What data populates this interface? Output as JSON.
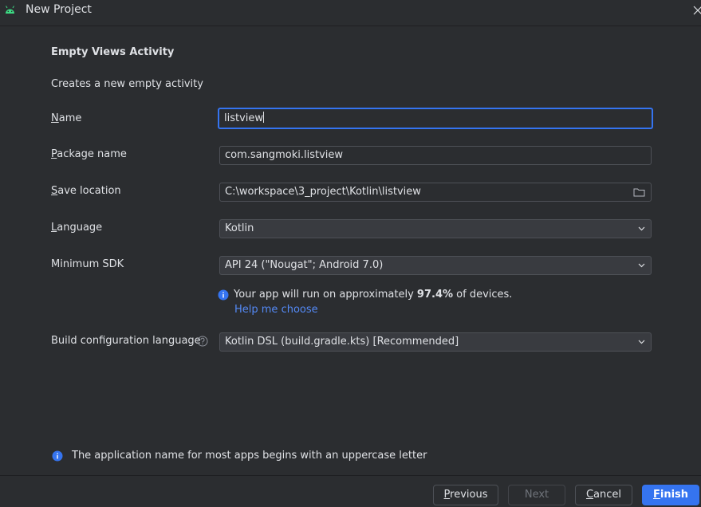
{
  "window": {
    "title": "New Project"
  },
  "template": {
    "title": "Empty Views Activity",
    "description": "Creates a new empty activity"
  },
  "form": {
    "name": {
      "label_mnemonic": "N",
      "label_rest": "ame",
      "value": "listview"
    },
    "package": {
      "label_mnemonic": "P",
      "label_rest": "ackage name",
      "value": "com.sangmoki.listview"
    },
    "save_location": {
      "label_mnemonic": "S",
      "label_rest": "ave location",
      "value": "C:\\workspace\\3_project\\Kotlin\\listview"
    },
    "language": {
      "label_mnemonic": "L",
      "label_rest": "anguage",
      "value": "Kotlin"
    },
    "min_sdk": {
      "label": "Minimum SDK",
      "value": "API 24 (\"Nougat\"; Android 7.0)"
    },
    "sdk_info": {
      "prefix": "Your app will run on approximately ",
      "percent": "97.4%",
      "suffix": " of devices.",
      "help_link": "Help me choose"
    },
    "build_config": {
      "label": "Build configuration language",
      "value": "Kotlin DSL (build.gradle.kts) [Recommended]"
    }
  },
  "bottom_note": "The application name for most apps begins with an uppercase letter",
  "buttons": {
    "previous": {
      "mnemonic": "P",
      "rest": "revious"
    },
    "next": "Next",
    "cancel": {
      "mnemonic": "C",
      "rest": "ancel"
    },
    "finish": {
      "mnemonic": "F",
      "rest": "inish"
    }
  },
  "colors": {
    "background": "#2b2d30",
    "accent": "#3574f0",
    "link": "#548af7",
    "android_green": "#3ddc84"
  },
  "icons": {
    "app": "android-icon",
    "close": "close-icon",
    "folder": "folder-icon",
    "dropdown": "chevron-down-icon",
    "info": "info-icon",
    "help": "question-icon"
  }
}
